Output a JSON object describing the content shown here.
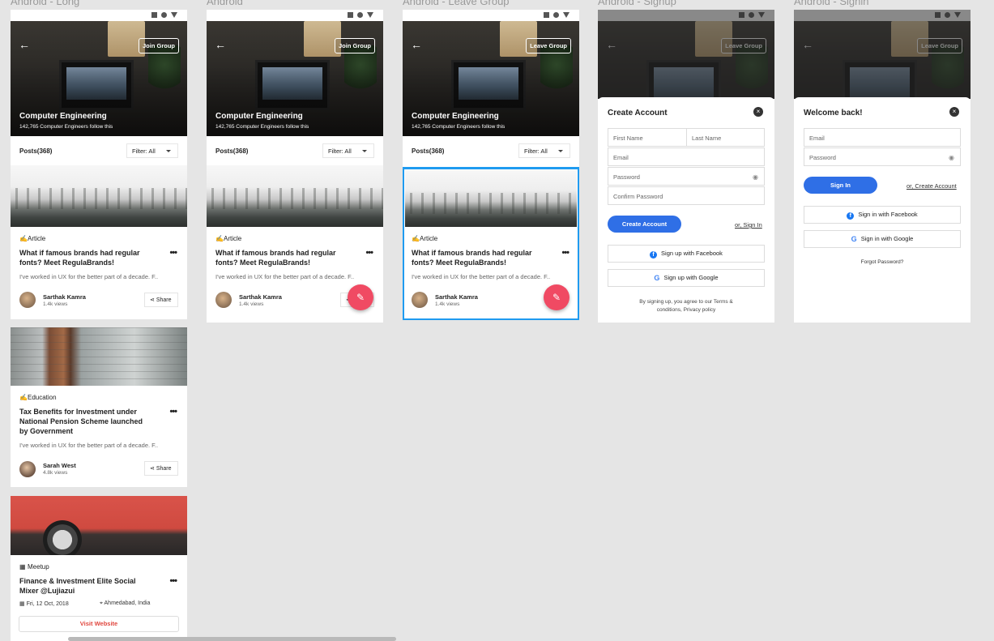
{
  "artboards": {
    "long": "Android - Long",
    "android": "Android",
    "leave": "Android - Leave Group",
    "signup": "Android - Signup",
    "signin": "Android - Signin"
  },
  "header": {
    "back_glyph": "←",
    "join_label": "Join Group",
    "leave_label": "Leave Group",
    "group_title": "Computer Engineering",
    "group_sub": "142,765 Computer Engineers follow this"
  },
  "posts": {
    "label": "Posts(368)",
    "filter": "Filter: All"
  },
  "article": {
    "tag": "Article",
    "title_line1": "What if famous brands had regular",
    "title_line2": "fonts? Meet RegulaBrands!",
    "excerpt": "I've worked in UX for the better part of a decade. F..",
    "author": "Sarthak Kamra",
    "views": "1.4k views",
    "share": "Share"
  },
  "education": {
    "tag": "Education",
    "title_line1": "Tax Benefits for Investment under",
    "title_line2": "National Pension Scheme launched",
    "title_line3": "by Government",
    "excerpt": "I've worked in UX for the better part of a decade. F..",
    "author": "Sarah West",
    "views": "4.8k views",
    "share": "Share"
  },
  "meetup": {
    "tag": "Meetup",
    "title_line1": "Finance & Investment Elite Social",
    "title_line2": "Mixer @Lujiazui",
    "date": "Fri, 12 Oct, 2018",
    "location": "Ahmedabad, India",
    "visit": "Visit Website"
  },
  "signup": {
    "title": "Create Account",
    "first_name": "First Name",
    "last_name": "Last Name",
    "email": "Email",
    "password": "Password",
    "confirm": "Confirm Password",
    "submit": "Create Account",
    "alt": "or, Sign In",
    "facebook": "Sign up with Facebook",
    "google": "Sign up with Google",
    "terms_line1": "By signing up, you agree to our Terms &",
    "terms_line2": "conditions, Privacy policy"
  },
  "signin": {
    "title": "Welcome back!",
    "email": "Email",
    "password": "Password",
    "submit": "Sign In",
    "alt": "or, Create Account",
    "facebook": "Sign in with Facebook",
    "google": "Sign in with Google",
    "forgot": "Forgot Password?"
  },
  "icons": {
    "close": "×",
    "eye": "◉",
    "dots": "•••",
    "pencil": "✎",
    "calendar": "▦",
    "pin": "⌖",
    "share": "⋖",
    "fb": "f",
    "g": "G"
  },
  "colors": {
    "primary": "#2f6fe6",
    "fab": "#f04a63",
    "selection": "#1f9bf0"
  }
}
